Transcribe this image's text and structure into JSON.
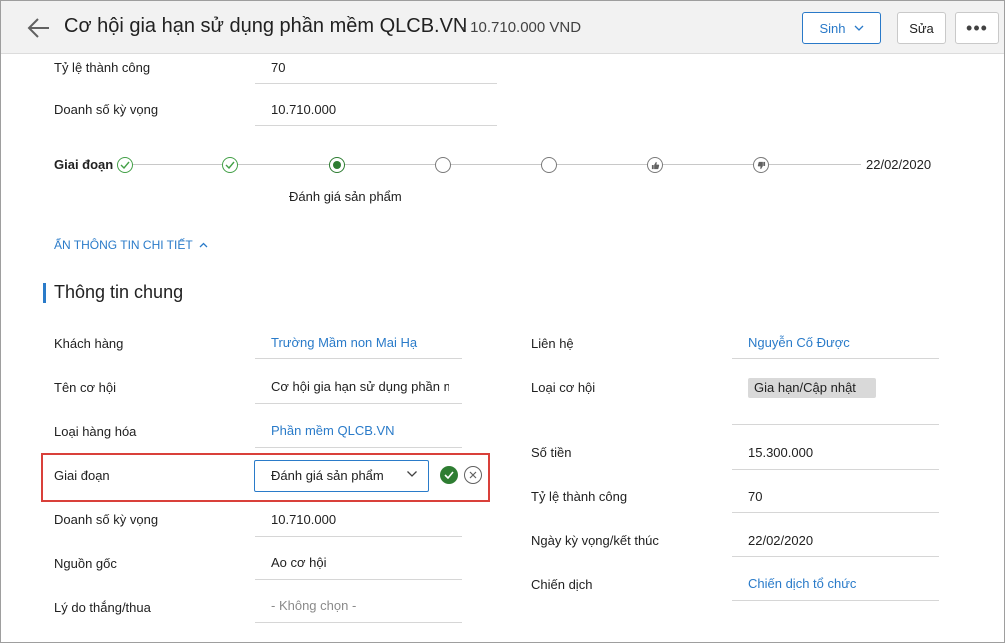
{
  "header": {
    "title": "Cơ hội gia hạn sử dụng phần mềm QLCB.VN",
    "amount": "- 10.710.000 VND",
    "generate_label": "Sinh",
    "edit_label": "Sửa",
    "more_label": "•••"
  },
  "top": {
    "success_rate_label": "Tỷ lệ thành công",
    "success_rate_value": "70",
    "expected_sales_label": "Doanh số kỳ vọng",
    "expected_sales_value": "10.710.000"
  },
  "stage_bar": {
    "label": "Giai đoạn",
    "current_stage_name": "Đánh giá sản phẩm",
    "end_date": "22/02/2020",
    "nodes": [
      "done",
      "done",
      "current",
      "pending",
      "pending",
      "won",
      "lost"
    ]
  },
  "toggle_details": "ẨN THÔNG TIN CHI TIẾT",
  "section": {
    "title": "Thông tin chung"
  },
  "left_fields": {
    "customer_label": "Khách hàng",
    "customer_value": "Trường Mầm non Mai Hạ",
    "opportunity_name_label": "Tên cơ hội",
    "opportunity_name_value": "Cơ hội gia hạn sử dụng phần mềm QLCB.VN",
    "goods_type_label": "Loại hàng hóa",
    "goods_type_value": "Phần mềm QLCB.VN",
    "stage_label": "Giai đoạn",
    "stage_value": "Đánh giá sản phẩm",
    "expected_sales_label": "Doanh số kỳ vọng",
    "expected_sales_value": "10.710.000",
    "source_label": "Nguồn gốc",
    "source_value": "Ao cơ hội",
    "win_loss_reason_label": "Lý do thắng/thua",
    "win_loss_reason_value": "- Không chọn -"
  },
  "right_fields": {
    "contact_label": "Liên hệ",
    "contact_value": "Nguyễn Cố Được",
    "opportunity_type_label": "Loại cơ hội",
    "opportunity_type_value": "Gia hạn/Cập nhật",
    "amount_label": "Số tiền",
    "amount_value": "15.300.000",
    "success_rate_label": "Tỷ lệ thành công",
    "success_rate_value": "70",
    "expected_date_label": "Ngày kỳ vọng/kết thúc",
    "expected_date_value": "22/02/2020",
    "campaign_label": "Chiến dịch",
    "campaign_value": "Chiến dịch tổ chức"
  },
  "colors": {
    "accent": "#2a7bc9",
    "success": "#2e7d32",
    "highlight": "#d9403a"
  },
  "icons": {
    "back": "arrow-left-icon",
    "dropdown": "chevron-down-icon",
    "confirm": "check-circle-icon",
    "cancel": "close-circle-icon",
    "won": "thumbs-up-icon",
    "lost": "thumbs-down-icon"
  }
}
